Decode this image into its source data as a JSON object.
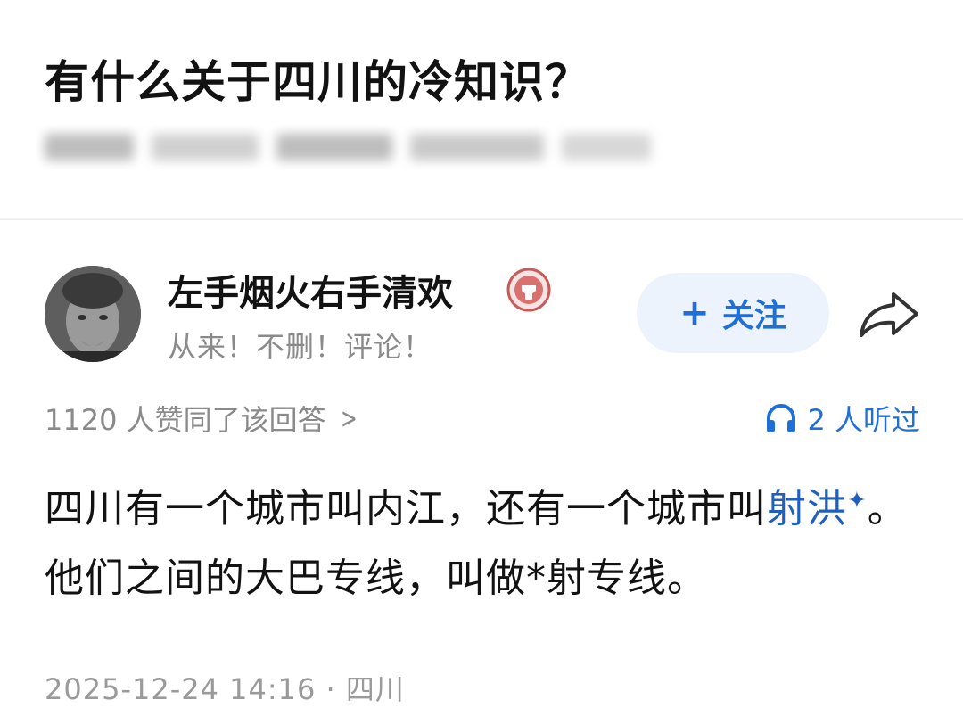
{
  "question": {
    "title": "有什么关于四川的冷知识？"
  },
  "author": {
    "name": "左手烟火右手清欢",
    "bio": "从来！不删！评论！",
    "follow_label": "关注"
  },
  "stats": {
    "upvotes": "1120 人赞同了该回答",
    "listeners": "2 人听过"
  },
  "answer": {
    "part1": "四川有一个城市叫内江，还有一个城市叫",
    "link_text": "射洪",
    "part2": "。他们之间的大巴专线，叫做*射专线。"
  },
  "footer": {
    "timestamp_location": "2025-12-24 14:16 · 四川"
  },
  "colors": {
    "accent": "#1f6fd6",
    "follow_bg": "#ecf3fd",
    "muted_text": "#8a8a8a"
  },
  "icons": {
    "badge": "badge-icon",
    "share": "share-icon",
    "headphone": "headphone-icon",
    "chevron": "chevron-right-icon"
  }
}
